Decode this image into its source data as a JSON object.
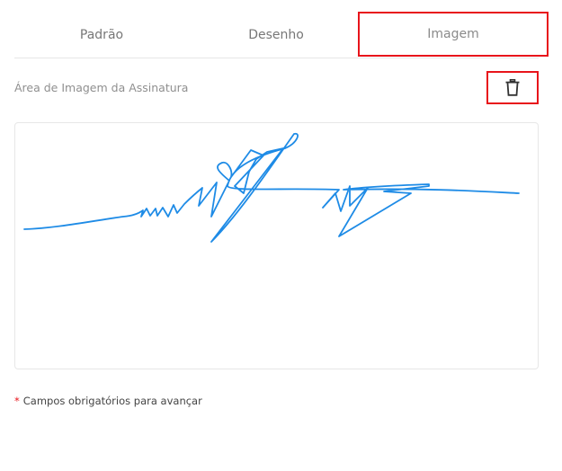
{
  "tabs": [
    {
      "label": "Padrão"
    },
    {
      "label": "Desenho"
    },
    {
      "label": "Imagem"
    }
  ],
  "signature_area": {
    "label": "Área de Imagem da Assinatura",
    "delete_icon": "trash-icon"
  },
  "footer": {
    "required_mark": "*",
    "required_text": "Campos obrigatórios para avançar"
  },
  "colors": {
    "highlight": "#e8141b",
    "signature_ink": "#1e8be6"
  }
}
